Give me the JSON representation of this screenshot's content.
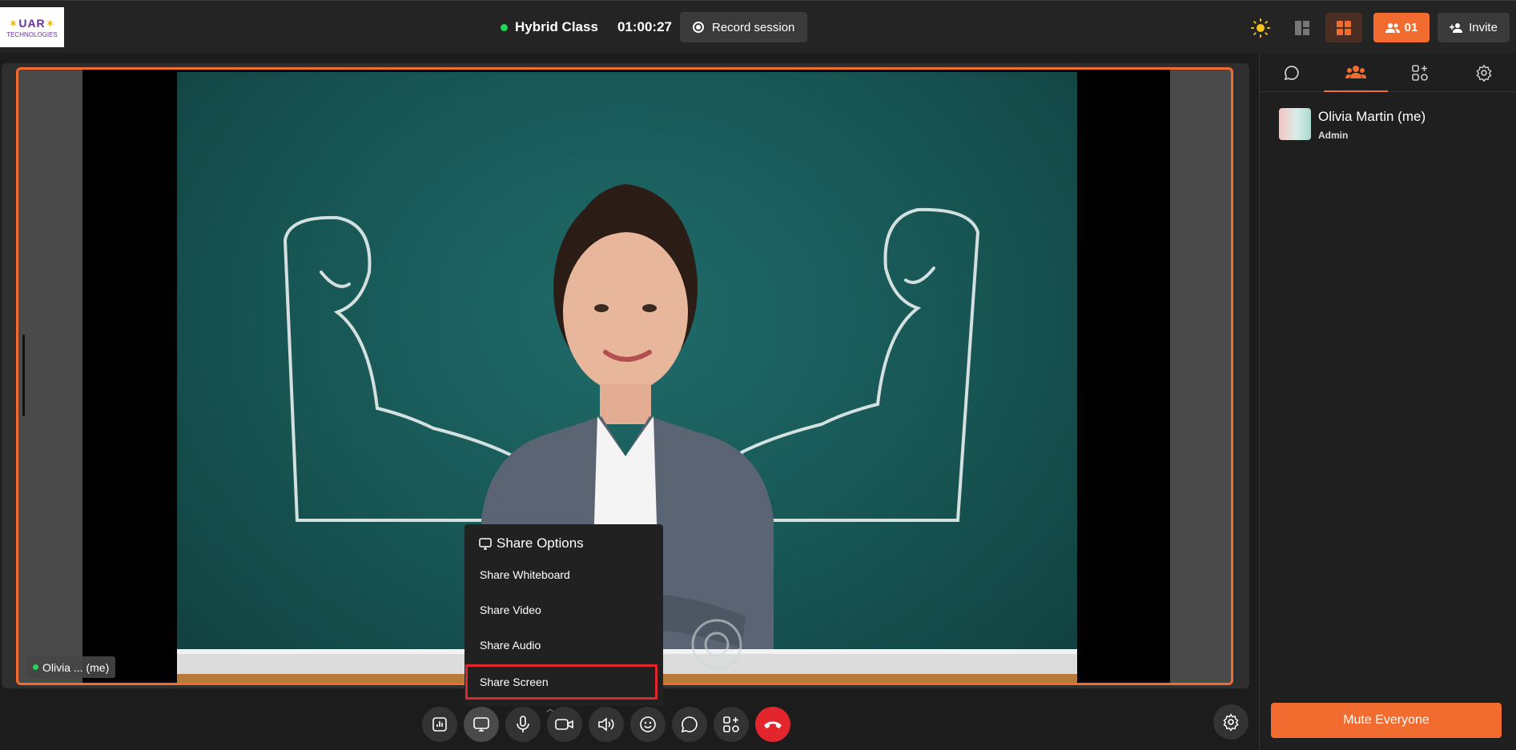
{
  "header": {
    "logo_line1": "UAR",
    "logo_line2": "TECHNOLOGIES",
    "class_title": "Hybrid Class",
    "timer": "01:00:27",
    "record_label": "Record session",
    "participants_count": "01",
    "invite_label": "Invite"
  },
  "stage": {
    "name_tag": "Olivia ... (me)",
    "accent_color": "#f26b2f"
  },
  "share_menu": {
    "title": "Share Options",
    "items": [
      "Share Whiteboard",
      "Share Video",
      "Share Audio",
      "Share Screen"
    ]
  },
  "toolbar": {
    "buttons": [
      "poll-icon",
      "share-screen-icon",
      "mic-icon",
      "camera-icon",
      "speaker-icon",
      "emoji-icon",
      "chat-icon",
      "apps-icon",
      "end-call-icon"
    ]
  },
  "panel": {
    "tabs": [
      "chat-icon",
      "participants-icon",
      "apps-icon",
      "settings-icon"
    ],
    "participant": {
      "name": "Olivia Martin (me)",
      "role": "Admin"
    },
    "mute_all_label": "Mute Everyone"
  }
}
